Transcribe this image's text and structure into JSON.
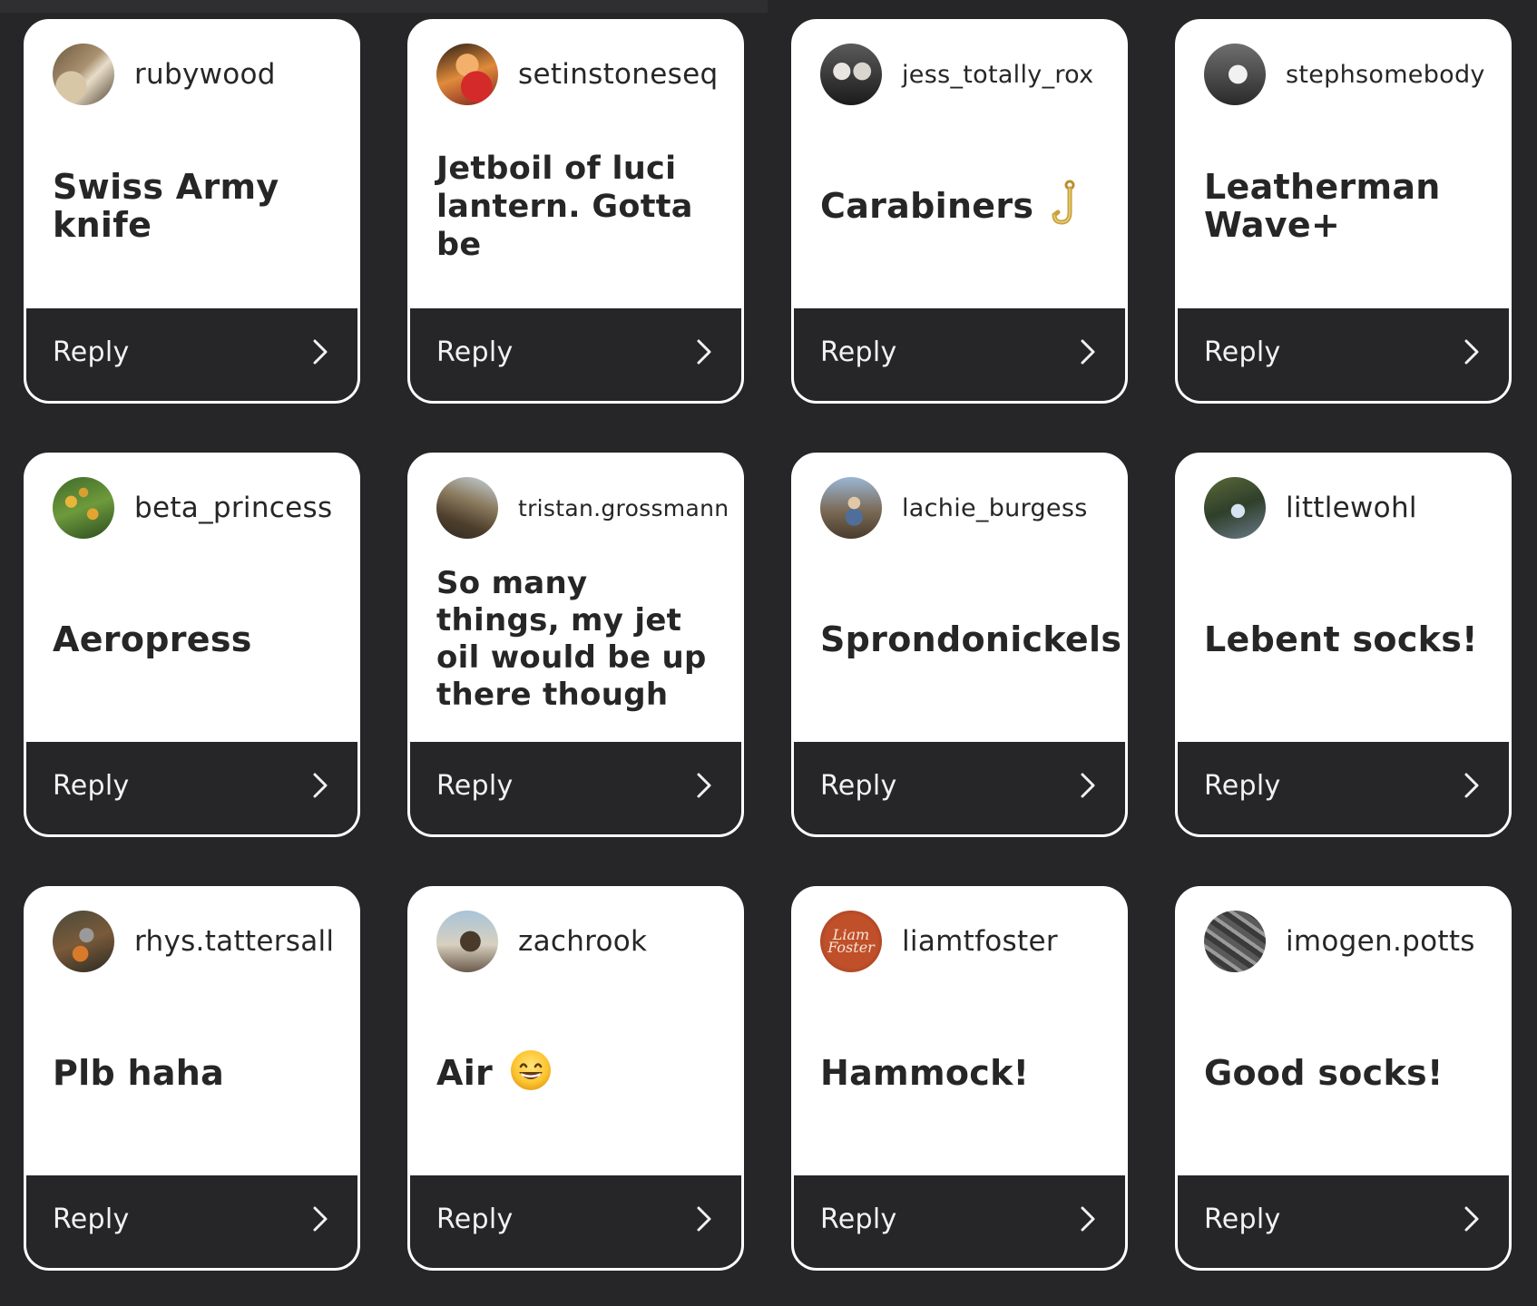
{
  "colors": {
    "background": "#262628",
    "card": "#ffffff",
    "reply_bar": "#262628",
    "text_dark": "#262626",
    "text_light": "#f2f2f2"
  },
  "cards": [
    {
      "username": "rubywood",
      "message": "Swiss Army knife",
      "reply": "Reply",
      "avatar_icon": "avatar-photo"
    },
    {
      "username": "setinstoneseq",
      "message": "Jetboil of luci lantern. Gotta be",
      "reply": "Reply",
      "avatar_icon": "avatar-photo"
    },
    {
      "username": "jess_totally_rox",
      "message": "Carabiners",
      "emoji": "hook-emoji",
      "reply": "Reply",
      "avatar_icon": "avatar-photo"
    },
    {
      "username": "stephsomebody",
      "message": "Leatherman Wave+",
      "reply": "Reply",
      "avatar_icon": "avatar-photo"
    },
    {
      "username": "beta_princess",
      "message": "Aeropress",
      "reply": "Reply",
      "avatar_icon": "avatar-photo"
    },
    {
      "username": "tristan.grossmann",
      "message": "So many things, my jet oil would be up there though",
      "reply": "Reply",
      "avatar_icon": "avatar-photo"
    },
    {
      "username": "lachie_burgess",
      "message": "Sprondonickels",
      "reply": "Reply",
      "avatar_icon": "avatar-photo"
    },
    {
      "username": "littlewohl",
      "message": "Lebent socks!",
      "reply": "Reply",
      "avatar_icon": "avatar-photo"
    },
    {
      "username": "rhys.tattersall",
      "message": "Plb haha",
      "reply": "Reply",
      "avatar_icon": "avatar-photo"
    },
    {
      "username": "zachrook",
      "message": "Air",
      "emoji": "grinning-face-emoji",
      "reply": "Reply",
      "avatar_icon": "avatar-photo"
    },
    {
      "username": "liamtfoster",
      "message": "Hammock!",
      "reply": "Reply",
      "avatar_icon": "avatar-logo"
    },
    {
      "username": "imogen.potts",
      "message": "Good socks!",
      "reply": "Reply",
      "avatar_icon": "avatar-photo"
    }
  ],
  "avatar_logo_text": "Liam Foster"
}
